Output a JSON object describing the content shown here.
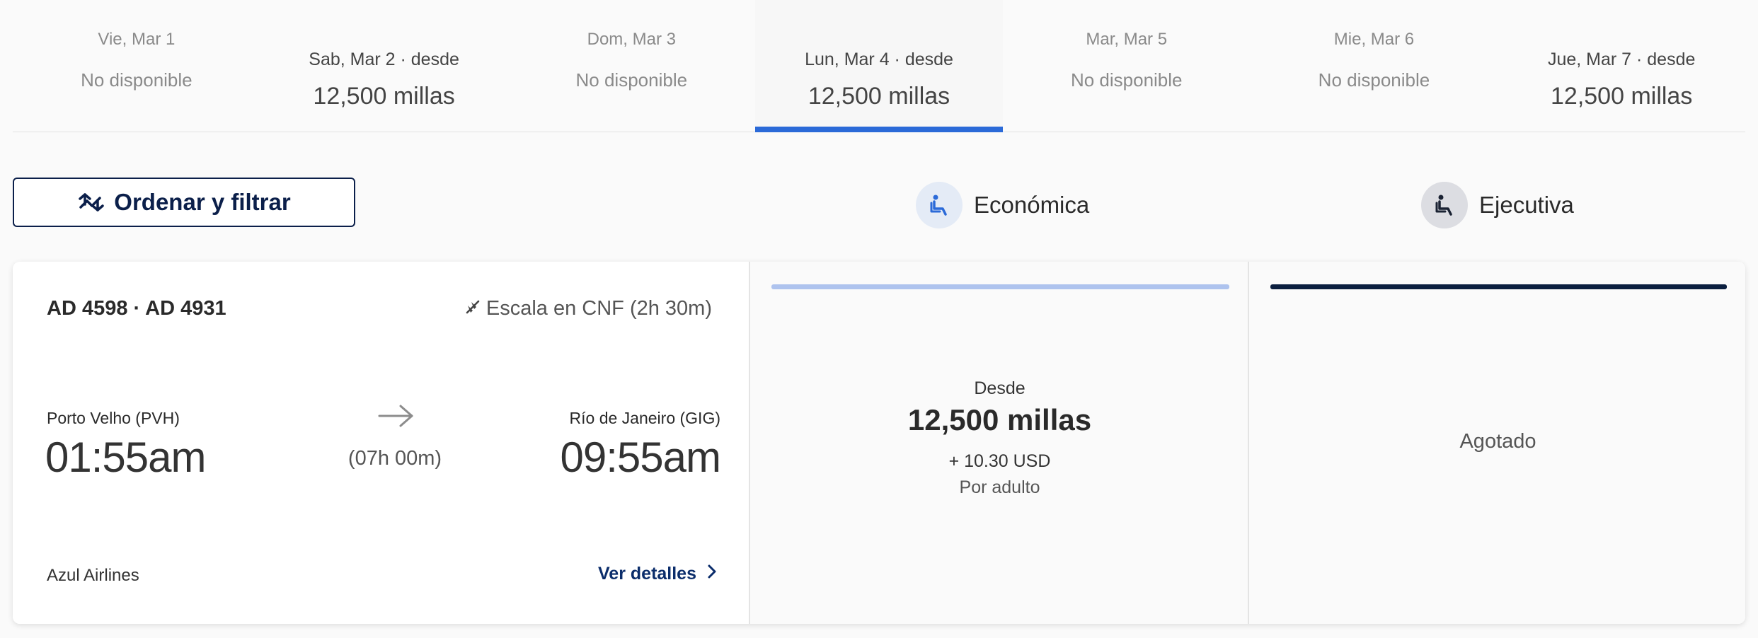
{
  "date_tabs": [
    {
      "date": "Vie, Mar 1",
      "status": "No disponible",
      "available": false
    },
    {
      "date": "Sab, Mar 2 · desde",
      "price": "12,500 millas",
      "available": true
    },
    {
      "date": "Dom, Mar 3",
      "status": "No disponible",
      "available": false
    },
    {
      "date": "Lun, Mar 4 · desde",
      "price": "12,500 millas",
      "available": true,
      "selected": true
    },
    {
      "date": "Mar, Mar 5",
      "status": "No disponible",
      "available": false
    },
    {
      "date": "Mie, Mar 6",
      "status": "No disponible",
      "available": false
    },
    {
      "date": "Jue, Mar 7 · desde",
      "price": "12,500 millas",
      "available": true
    }
  ],
  "filter_button": {
    "label": "Ordenar y filtrar",
    "icon": "sort-arrows-icon"
  },
  "cabins": {
    "economy": {
      "label": "Económica",
      "icon": "seat-icon"
    },
    "executive": {
      "label": "Ejecutiva",
      "icon": "seat-icon"
    }
  },
  "flight": {
    "numbers": "AD 4598 · AD 4931",
    "stop": "Escala en CNF (2h 30m)",
    "origin": {
      "name": "Porto Velho (PVH)",
      "time": "01:55am"
    },
    "destination": {
      "name": "Río de Janeiro (GIG)",
      "time": "09:55am"
    },
    "duration": "(07h 00m)",
    "airline": "Azul Airlines",
    "details_label": "Ver detalles"
  },
  "fares": {
    "economy": {
      "from": "Desde",
      "price": "12,500 millas",
      "tax": "+ 10.30 USD",
      "per": "Por adulto"
    },
    "executive": {
      "status": "Agotado"
    }
  },
  "colors": {
    "accent": "#2b6ad8",
    "navy": "#0b1f4a",
    "economy_bar": "#aec3ee",
    "executive_bar": "#0b1f3f"
  }
}
